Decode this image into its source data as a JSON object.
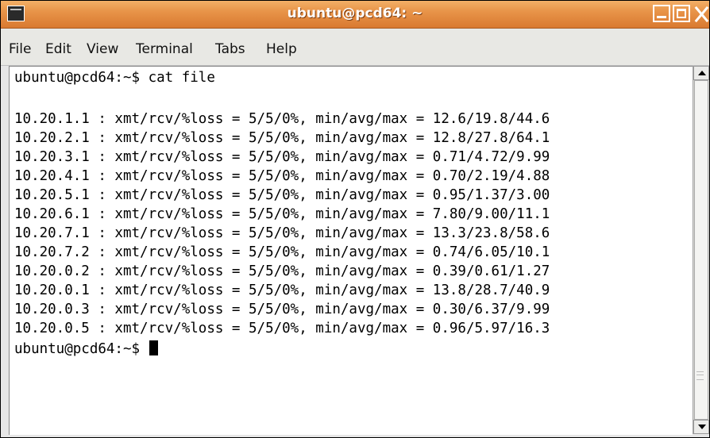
{
  "window": {
    "title": "ubuntu@pcd64: ~"
  },
  "menu": {
    "items": [
      {
        "label": "File"
      },
      {
        "label": "Edit"
      },
      {
        "label": "View"
      },
      {
        "label": "Terminal"
      },
      {
        "label": "Tabs"
      },
      {
        "label": "Help"
      }
    ]
  },
  "terminal": {
    "lines": [
      "ubuntu@pcd64:~$ cat file",
      "",
      "10.20.1.1 : xmt/rcv/%loss = 5/5/0%, min/avg/max = 12.6/19.8/44.6",
      "10.20.2.1 : xmt/rcv/%loss = 5/5/0%, min/avg/max = 12.8/27.8/64.1",
      "10.20.3.1 : xmt/rcv/%loss = 5/5/0%, min/avg/max = 0.71/4.72/9.99",
      "10.20.4.1 : xmt/rcv/%loss = 5/5/0%, min/avg/max = 0.70/2.19/4.88",
      "10.20.5.1 : xmt/rcv/%loss = 5/5/0%, min/avg/max = 0.95/1.37/3.00",
      "10.20.6.1 : xmt/rcv/%loss = 5/5/0%, min/avg/max = 7.80/9.00/11.1",
      "10.20.7.1 : xmt/rcv/%loss = 5/5/0%, min/avg/max = 13.3/23.8/58.6",
      "10.20.7.2 : xmt/rcv/%loss = 5/5/0%, min/avg/max = 0.74/6.05/10.1",
      "10.20.0.2 : xmt/rcv/%loss = 5/5/0%, min/avg/max = 0.39/0.61/1.27",
      "10.20.0.1 : xmt/rcv/%loss = 5/5/0%, min/avg/max = 13.8/28.7/40.9",
      "10.20.0.3 : xmt/rcv/%loss = 5/5/0%, min/avg/max = 0.30/6.37/9.99",
      "10.20.0.5 : xmt/rcv/%loss = 5/5/0%, min/avg/max = 0.96/5.97/16.3"
    ],
    "prompt": "ubuntu@pcd64:~$ "
  }
}
